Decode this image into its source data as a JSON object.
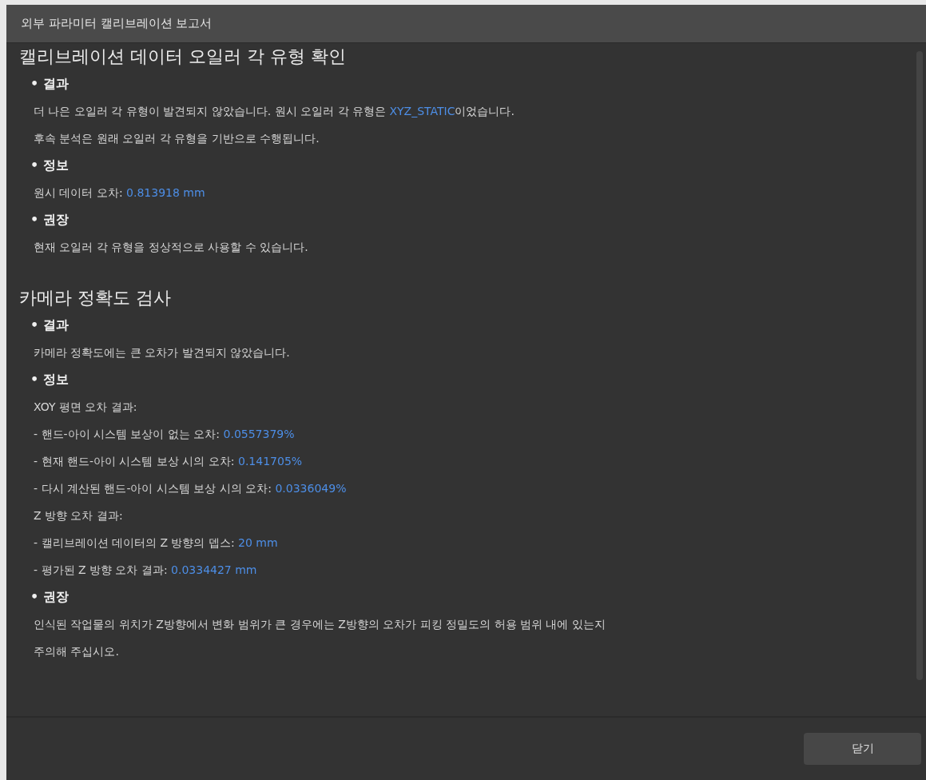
{
  "window": {
    "title": "외부 파라미터 캘리브레이션 보고서"
  },
  "sections": [
    {
      "heading": "캘리브레이션 데이터 오일러 각 유형 확인",
      "blocks": [
        {
          "label": "• 결과",
          "lines": [
            [
              {
                "text": "더 나은 오일러 각 유형이 발견되지 않았습니다. 원시 오일러 각 유형은 ",
                "kind": "plain"
              },
              {
                "text": "XYZ_STATIC",
                "kind": "value"
              },
              {
                "text": "이었습니다.",
                "kind": "plain"
              }
            ],
            [
              {
                "text": "후속 분석은 원래 오일러 각 유형을 기반으로 수행됩니다.",
                "kind": "plain"
              }
            ]
          ]
        },
        {
          "label": "• 정보",
          "lines": [
            [
              {
                "text": "원시 데이터 오차: ",
                "kind": "plain"
              },
              {
                "text": "0.813918 mm",
                "kind": "value"
              }
            ]
          ]
        },
        {
          "label": "• 권장",
          "lines": [
            [
              {
                "text": "현재 오일러 각 유형을 정상적으로 사용할 수 있습니다.",
                "kind": "plain"
              }
            ]
          ]
        }
      ]
    },
    {
      "heading": "카메라 정확도 검사",
      "blocks": [
        {
          "label": "• 결과",
          "lines": [
            [
              {
                "text": "카메라 정확도에는 큰 오차가 발견되지 않았습니다.",
                "kind": "plain"
              }
            ]
          ]
        },
        {
          "label": "• 정보",
          "lines": [
            [
              {
                "text": "XOY 평면 오차 결과:",
                "kind": "plain"
              }
            ],
            [
              {
                "text": "- 핸드-아이 시스템 보상이 없는 오차: ",
                "kind": "plain"
              },
              {
                "text": "0.0557379%",
                "kind": "value"
              }
            ],
            [
              {
                "text": "- 현재 핸드-아이 시스템 보상 시의 오차: ",
                "kind": "plain"
              },
              {
                "text": "0.141705%",
                "kind": "value"
              }
            ],
            [
              {
                "text": "- 다시 계산된 핸드-아이 시스템 보상 시의 오차: ",
                "kind": "plain"
              },
              {
                "text": "0.0336049%",
                "kind": "value"
              }
            ],
            [
              {
                "text": "Z 방향 오차 결과:",
                "kind": "plain"
              }
            ],
            [
              {
                "text": "- 캘리브레이션 데이터의 Z 방향의 뎁스: ",
                "kind": "plain"
              },
              {
                "text": "20 mm",
                "kind": "value"
              }
            ],
            [
              {
                "text": "- 평가된 Z 방향 오차 결과: ",
                "kind": "plain"
              },
              {
                "text": "0.0334427 mm",
                "kind": "value"
              }
            ]
          ]
        },
        {
          "label": "• 권장",
          "lines": [
            [
              {
                "text": "인식된 작업물의 위치가 Z방향에서 변화 범위가 큰 경우에는 Z방향의 오차가 피킹 정밀도의 허용 범위 내에 있는지",
                "kind": "plain"
              }
            ],
            [
              {
                "text": "주의해 주십시오.",
                "kind": "plain"
              }
            ]
          ]
        }
      ]
    }
  ],
  "buttons": [
    {
      "label": "닫기"
    }
  ]
}
